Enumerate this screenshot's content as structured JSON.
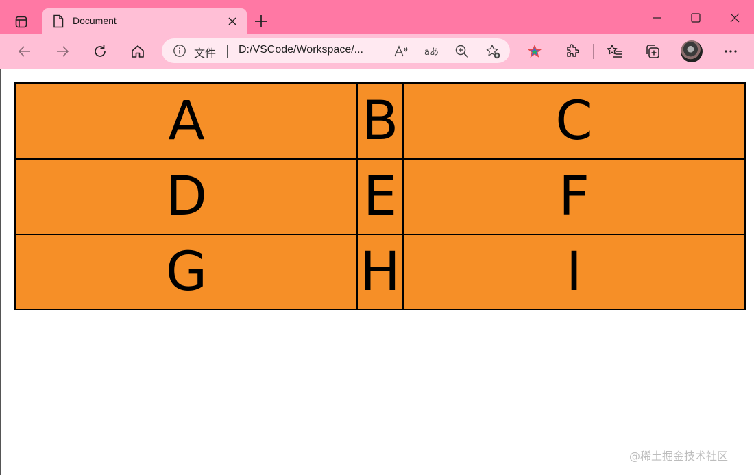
{
  "window": {
    "tab_title": "Document"
  },
  "toolbar": {
    "address_scheme": "文件",
    "address_url": "D:/VSCode/Workspace/..."
  },
  "page": {
    "cells": [
      "A",
      "B",
      "C",
      "D",
      "E",
      "F",
      "G",
      "H",
      "I"
    ],
    "cell_color": "#f68f27",
    "border_color": "#000000"
  },
  "watermark": "@稀土掘金技术社区",
  "colors": {
    "titlebar": "#ff78a4",
    "toolbar": "#ffbfd6"
  }
}
